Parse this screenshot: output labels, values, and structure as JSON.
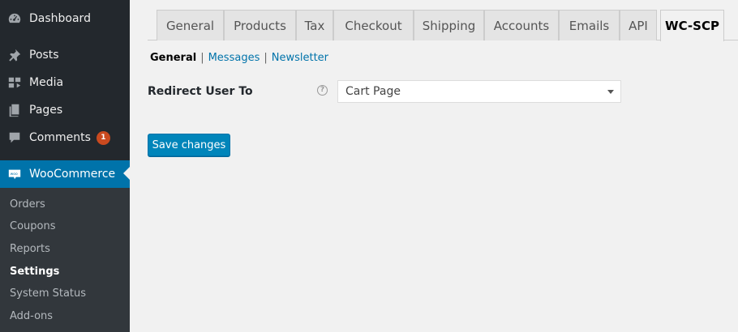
{
  "sidebar": {
    "items": [
      {
        "label": "Dashboard",
        "icon": "dashboard-icon"
      },
      {
        "label": "Posts",
        "icon": "pin-icon"
      },
      {
        "label": "Media",
        "icon": "media-icon"
      },
      {
        "label": "Pages",
        "icon": "pages-icon"
      },
      {
        "label": "Comments",
        "icon": "comment-icon",
        "badge": "1"
      },
      {
        "label": "WooCommerce",
        "icon": "woo-icon"
      }
    ],
    "submenu": [
      "Orders",
      "Coupons",
      "Reports",
      "Settings",
      "System Status",
      "Add-ons"
    ],
    "active_submenu": "Settings"
  },
  "tabs": [
    "General",
    "Products",
    "Tax",
    "Checkout",
    "Shipping",
    "Accounts",
    "Emails",
    "API",
    "WC-SCP"
  ],
  "active_tab": "WC-SCP",
  "subnav": {
    "current": "General",
    "links": [
      "Messages",
      "Newsletter"
    ],
    "separator": "|"
  },
  "form": {
    "label": "Redirect User To",
    "help_glyph": "?",
    "select_value": "Cart Page"
  },
  "save_label": "Save changes",
  "colors": {
    "sidebar": "#23282d",
    "accent": "#0073aa",
    "button": "#0085ba",
    "badge": "#ca4a1f"
  }
}
